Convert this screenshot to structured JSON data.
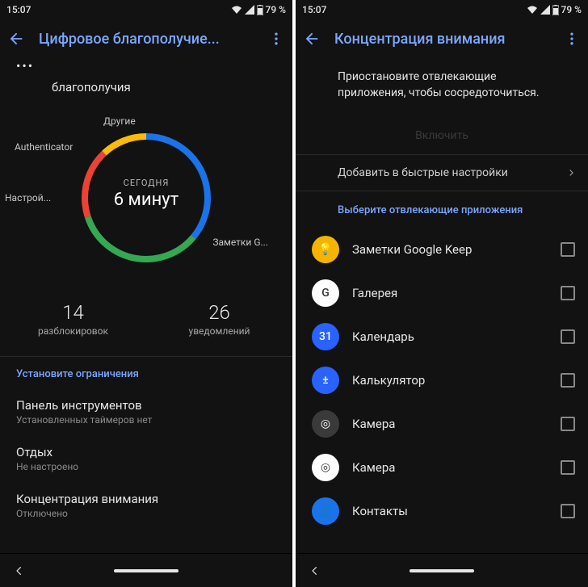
{
  "status": {
    "time": "15:07",
    "battery": "79 %"
  },
  "left": {
    "title": "Цифровое благополучие...",
    "subtitle": "благополучия",
    "chart": {
      "today": "СЕГОДНЯ",
      "value": "6 минут",
      "labels": {
        "other": "Другие",
        "auth": "Authenticator",
        "settings": "Настрой...",
        "keep": "Заметки G..."
      }
    },
    "stats": {
      "unlocks_n": "14",
      "unlocks_l": "разблокировок",
      "notif_n": "26",
      "notif_l": "уведомлений"
    },
    "section": "Установите ограничения",
    "rows": [
      {
        "t": "Панель инструментов",
        "s": "Установленных таймеров нет"
      },
      {
        "t": "Отдых",
        "s": "Не настроено"
      },
      {
        "t": "Концентрация внимания",
        "s": "Отключено"
      }
    ]
  },
  "right": {
    "title": "Концентрация внимания",
    "desc": "Приостановите отвлекающие приложения, чтобы сосредоточиться.",
    "enable": "Включить",
    "quick": "Добавить в быстрые настройки",
    "select": "Выберите отвлекающие приложения",
    "apps": [
      {
        "name": "Заметки Google Keep",
        "bg": "#f5b400",
        "glyph": "💡"
      },
      {
        "name": "Галерея",
        "bg": "#ffffff",
        "glyph": "G"
      },
      {
        "name": "Календарь",
        "bg": "#2962ff",
        "glyph": "31"
      },
      {
        "name": "Калькулятор",
        "bg": "#2962ff",
        "glyph": "±"
      },
      {
        "name": "Камера",
        "bg": "#3a3a3a",
        "glyph": "◎"
      },
      {
        "name": "Камера",
        "bg": "#ffffff",
        "glyph": "◎"
      },
      {
        "name": "Контакты",
        "bg": "#1a73e8",
        "glyph": "👤"
      }
    ]
  },
  "chart_data": {
    "type": "pie",
    "title": "СЕГОДНЯ 6 минут",
    "categories": [
      "Другие",
      "Заметки G...",
      "Настрой...",
      "Authenticator"
    ],
    "values": [
      36,
      34,
      18,
      12
    ],
    "colors": [
      "#1a73e8",
      "#34a853",
      "#ea4335",
      "#fbbc04"
    ]
  }
}
